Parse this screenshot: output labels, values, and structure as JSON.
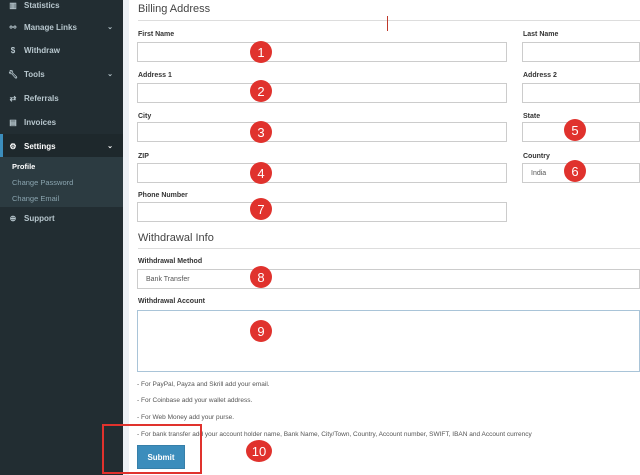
{
  "sidebar": {
    "items": [
      {
        "label": "Statistics",
        "icon": "chart-icon"
      },
      {
        "label": "Manage Links",
        "icon": "link-icon",
        "chevron": true
      },
      {
        "label": "Withdraw",
        "icon": "dollar-icon"
      },
      {
        "label": "Tools",
        "icon": "wrench-icon",
        "chevron": true
      },
      {
        "label": "Referrals",
        "icon": "exchange-icon"
      },
      {
        "label": "Invoices",
        "icon": "file-icon"
      },
      {
        "label": "Settings",
        "icon": "cogs-icon",
        "chevron": true,
        "active": true
      },
      {
        "label": "Support",
        "icon": "lifebuoy-icon"
      }
    ],
    "submenu": [
      "Profile",
      "Change Password",
      "Change Email"
    ]
  },
  "billing": {
    "title": "Billing Address",
    "first_name_label": "First Name",
    "last_name_label": "Last Name",
    "address1_label": "Address 1",
    "address2_label": "Address 2",
    "city_label": "City",
    "state_label": "State",
    "zip_label": "ZIP",
    "country_label": "Country",
    "country_value": "India",
    "phone_label": "Phone Number"
  },
  "withdrawal": {
    "title": "Withdrawal Info",
    "method_label": "Withdrawal Method",
    "method_value": "Bank Transfer",
    "account_label": "Withdrawal Account",
    "notes": [
      "- For PayPal, Payza and Skrill add your email.",
      "- For Coinbase add your wallet address.",
      "- For Web Money add your purse.",
      "- For bank transfer add your account holder name, Bank Name, City/Town, Country, Account number, SWIFT, IBAN and Account currency"
    ]
  },
  "submit_label": "Submit",
  "markers": [
    "1",
    "2",
    "3",
    "4",
    "5",
    "6",
    "7",
    "8",
    "9",
    "10"
  ],
  "colors": {
    "sidebar_bg": "#222d32",
    "accent": "#3c8dbc",
    "marker": "#e0322d"
  }
}
